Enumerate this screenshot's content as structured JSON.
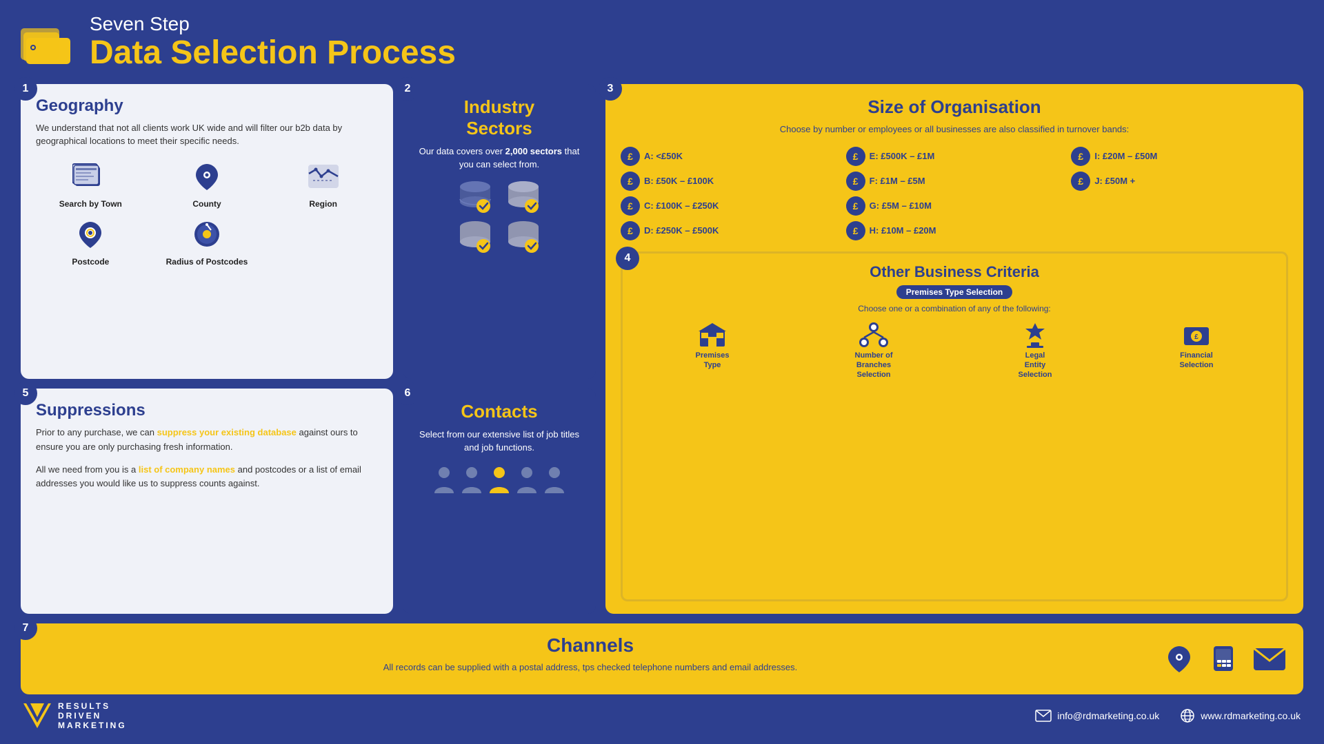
{
  "header": {
    "subtitle": "Seven Step",
    "title": "Data Selection Process"
  },
  "steps": {
    "step1": {
      "number": "1",
      "title": "Geography",
      "description": "We understand that not all clients work UK wide and will filter our b2b data by geographical locations to meet their specific needs.",
      "icons": [
        {
          "name": "Search by Town",
          "id": "search-by-town"
        },
        {
          "name": "County",
          "id": "county"
        },
        {
          "name": "Region",
          "id": "region"
        },
        {
          "name": "Postcode",
          "id": "postcode"
        },
        {
          "name": "Radius of Postcodes",
          "id": "radius-of-postcodes"
        }
      ]
    },
    "step2": {
      "number": "2",
      "title": "Industry Sectors",
      "description": "Our data covers over ",
      "highlight": "2,000 sectors",
      "description2": " that you can select from."
    },
    "step3": {
      "number": "3",
      "title": "Size of Organisation",
      "description": "Choose by number or employees or all businesses are also classified in turnover bands:",
      "bands": [
        {
          "label": "A: <£50K"
        },
        {
          "label": "E: £500K – £1M"
        },
        {
          "label": "I: £20M – £50M"
        },
        {
          "label": "B: £50K – £100K"
        },
        {
          "label": "F: £1M – £5M"
        },
        {
          "label": "J: £50M +"
        },
        {
          "label": "C: £100K – £250K"
        },
        {
          "label": "G: £5M – £10M"
        },
        {
          "label": ""
        },
        {
          "label": "D: £250K – £500K"
        },
        {
          "label": "H: £10M – £20M"
        },
        {
          "label": ""
        }
      ]
    },
    "step4": {
      "number": "4",
      "title": "Other Business Criteria",
      "badge": "Premises Type Selection",
      "description": "Choose one or a combination of any of the following:",
      "icons": [
        {
          "name": "Premises Type",
          "id": "premises-type"
        },
        {
          "name": "Number of Branches Selection",
          "id": "branches-selection"
        },
        {
          "name": "Legal Entity Selection",
          "id": "legal-entity"
        },
        {
          "name": "Financial Selection",
          "id": "financial-selection"
        }
      ]
    },
    "step5": {
      "number": "5",
      "title": "Suppressions",
      "p1_pre": "Prior to any purchase, we can ",
      "p1_highlight": "suppress your existing database",
      "p1_post": " against ours to ensure you are only purchasing fresh information.",
      "p2_pre": "All we need from you is a ",
      "p2_highlight": "list of company names",
      "p2_post": " and postcodes or a list of email addresses you would like us to suppress counts against."
    },
    "step6": {
      "number": "6",
      "title": "Contacts",
      "description": "Select from our extensive list of job titles and job functions."
    },
    "step7": {
      "number": "7",
      "title": "Channels",
      "description": "All records can be supplied with a postal address, tps checked telephone numbers and email addresses."
    }
  },
  "footer": {
    "logo_lines": [
      "RESULTS",
      "DRIVEN",
      "MARKETING"
    ],
    "email_label": "info@rdmarketing.co.uk",
    "website_label": "www.rdmarketing.co.uk"
  },
  "colors": {
    "blue": "#2d3f8f",
    "yellow": "#f5c518",
    "white": "#ffffff",
    "light_bg": "#e8ebf5"
  }
}
